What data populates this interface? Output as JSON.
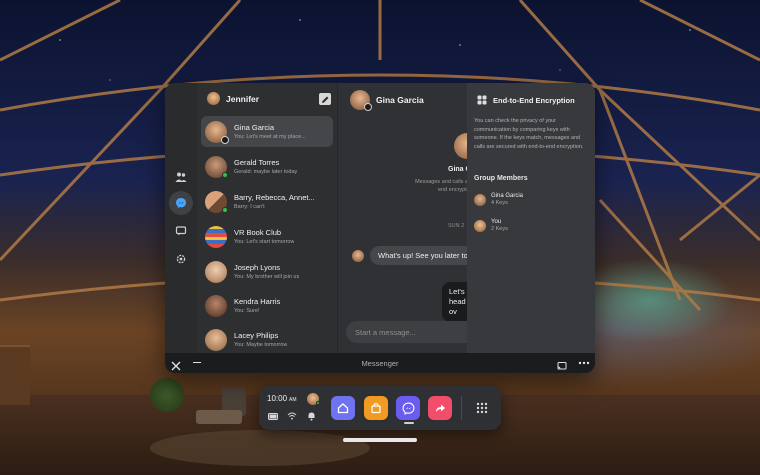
{
  "chat_list": {
    "user_name": "Jennifer",
    "items": [
      {
        "name": "Gina Garcia",
        "preview": "You: Let's meet at my place...",
        "selected": true
      },
      {
        "name": "Gerald Torres",
        "preview": "Gerald: maybe later today",
        "selected": false
      },
      {
        "name": "Barry, Rebecca, Annet...",
        "preview": "Barry: I can't",
        "selected": false
      },
      {
        "name": "VR Book Club",
        "preview": "You: Let's start tomorrow",
        "selected": false
      },
      {
        "name": "Joseph Lyons",
        "preview": "You: My brother will join us",
        "selected": false
      },
      {
        "name": "Kendra Harris",
        "preview": "You: Sure!",
        "selected": false
      },
      {
        "name": "Lacey Philips",
        "preview": "You: Maybe tomorrow",
        "selected": false
      }
    ]
  },
  "conversation": {
    "contact_name": "Gina Garcia",
    "center_name": "Gina G",
    "info_line1": "Messages and calls a",
    "info_line2": "end encrypti",
    "timestamp": "SUN 2",
    "incoming_message": "What's up! See you later tod",
    "outgoing_message": "Let's m head ov",
    "composer_placeholder": "Start a message..."
  },
  "encryption_panel": {
    "title": "End-to-End Encryption",
    "description": "You can check the privacy of your communication by comparing keys with someone. If the keys match, messages and calls are secured with end-to-end encryption.",
    "members_title": "Group Members",
    "members": [
      {
        "name": "Gina Garcia",
        "keys": "4 Keys"
      },
      {
        "name": "You",
        "keys": "2 Keys"
      }
    ]
  },
  "window": {
    "title": "Messenger"
  },
  "dock": {
    "time": "10:00",
    "ampm": "AM"
  },
  "colors": {
    "online": "#31c04a",
    "home_tile": "#6f73f0",
    "store_tile": "#f29b22",
    "messenger_tile": "#6b5cf0",
    "share_tile": "#f24d6b"
  }
}
